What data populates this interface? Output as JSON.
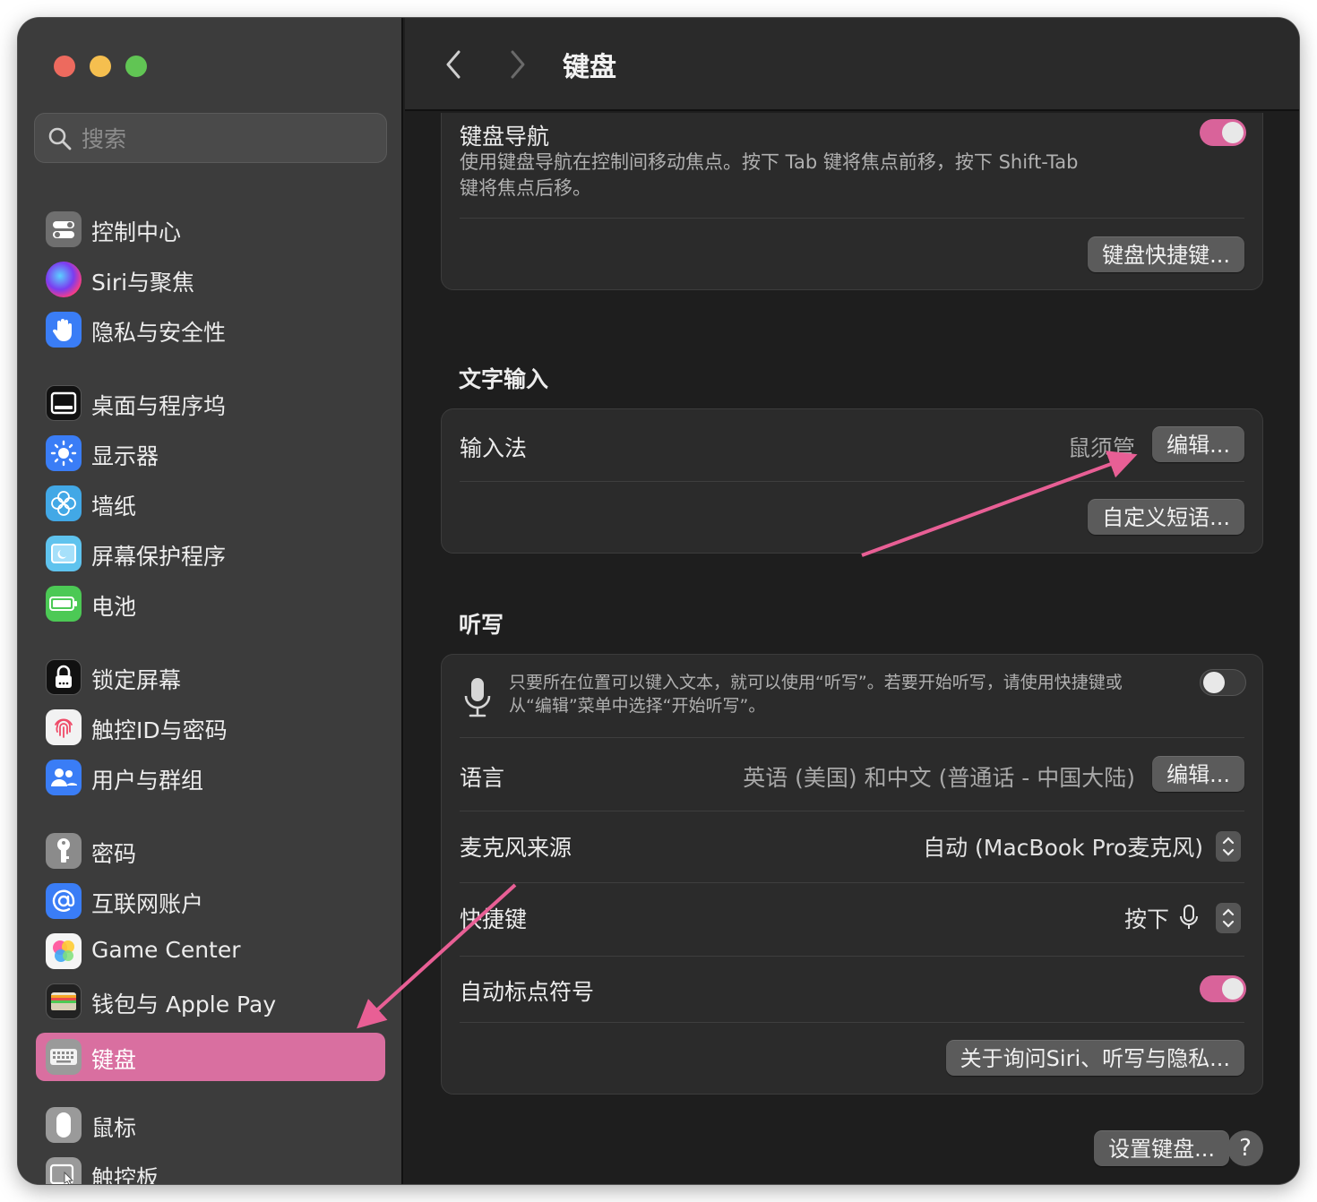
{
  "sidebar": {
    "search_placeholder": "搜索",
    "items": [
      {
        "label": "控制中心",
        "icon": "control-center-icon"
      },
      {
        "label": "Siri与聚焦",
        "icon": "siri-icon"
      },
      {
        "label": "隐私与安全性",
        "icon": "privacy-hand-icon"
      },
      {
        "label": "桌面与程序坞",
        "icon": "dock-icon"
      },
      {
        "label": "显示器",
        "icon": "display-brightness-icon"
      },
      {
        "label": "墙纸",
        "icon": "wallpaper-flower-icon"
      },
      {
        "label": "屏幕保护程序",
        "icon": "screensaver-icon"
      },
      {
        "label": "电池",
        "icon": "battery-icon"
      },
      {
        "label": "锁定屏幕",
        "icon": "lock-icon"
      },
      {
        "label": "触控ID与密码",
        "icon": "fingerprint-icon"
      },
      {
        "label": "用户与群组",
        "icon": "users-icon"
      },
      {
        "label": "密码",
        "icon": "key-icon"
      },
      {
        "label": "互联网账户",
        "icon": "at-sign-icon"
      },
      {
        "label": "Game Center",
        "icon": "game-center-icon"
      },
      {
        "label": "钱包与 Apple Pay",
        "icon": "wallet-icon"
      },
      {
        "label": "键盘",
        "icon": "keyboard-icon",
        "selected": true
      },
      {
        "label": "鼠标",
        "icon": "mouse-icon"
      },
      {
        "label": "触控板",
        "icon": "trackpad-icon"
      }
    ]
  },
  "toolbar": {
    "title": "键盘",
    "back_icon": "chevron-left-icon",
    "forward_icon": "chevron-right-icon"
  },
  "keyboard_nav": {
    "title": "键盘导航",
    "desc_line1": "使用键盘导航在控制间移动焦点。按下 Tab 键将焦点前移，按下 Shift-Tab",
    "desc_line2": "键将焦点后移。",
    "toggle_on": true,
    "shortcuts_button": "键盘快捷键..."
  },
  "text_input": {
    "section_title": "文字输入",
    "input_method_label": "输入法",
    "input_method_value": "鼠须管",
    "edit_button": "编辑...",
    "custom_phrases_button": "自定义短语..."
  },
  "dictation": {
    "section_title": "听写",
    "desc_line1": "只要所在位置可以键入文本，就可以使用“听写”。若要开始听写，请使用快捷键或",
    "desc_line2": "从“编辑”菜单中选择“开始听写”。",
    "toggle_on": false,
    "language_label": "语言",
    "language_value": "英语 (美国) 和中文 (普通话 - 中国大陆)",
    "language_edit_button": "编辑...",
    "mic_label": "麦克风来源",
    "mic_value": "自动 (MacBook Pro麦克风)",
    "shortcut_label": "快捷键",
    "shortcut_value": "按下",
    "auto_punct_label": "自动标点符号",
    "auto_punct_on": true,
    "privacy_button": "关于询问Siri、听写与隐私..."
  },
  "footer": {
    "setup_button": "设置键盘...",
    "help_button": "?"
  },
  "colors": {
    "accent_pink": "#d96fa0",
    "toggle_on": "#d9639a",
    "annotation_arrow": "#e85f95"
  }
}
